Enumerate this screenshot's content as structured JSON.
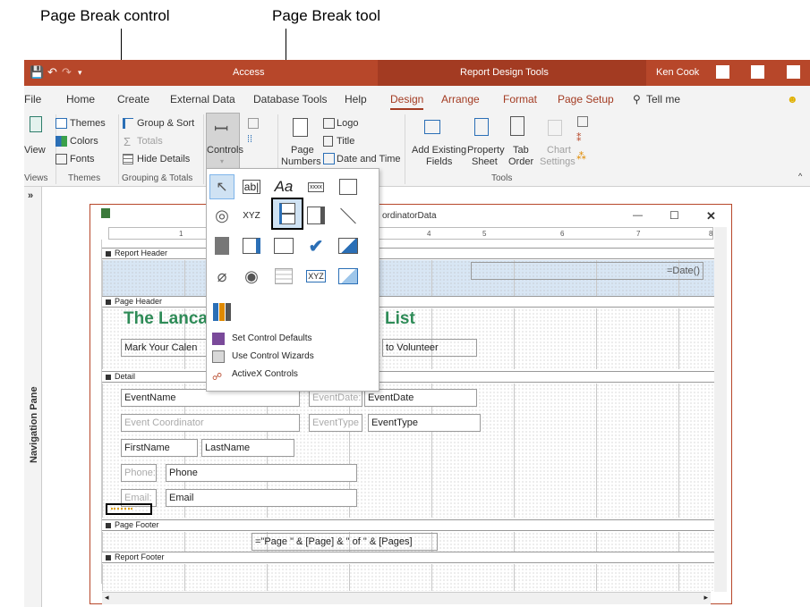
{
  "callouts": {
    "left": "Page Break control",
    "right": "Page Break tool"
  },
  "titlebar": {
    "app": "Access",
    "context": "Report Design Tools",
    "user": "Ken Cook",
    "quick_access": [
      "💾",
      "↶",
      "↷",
      "▾"
    ]
  },
  "tabs": [
    "File",
    "Home",
    "Create",
    "External Data",
    "Database Tools",
    "Help",
    "Design",
    "Arrange",
    "Format",
    "Page Setup"
  ],
  "tell_me": "Tell me",
  "ribbon": {
    "views": {
      "label": "View",
      "group": "Views"
    },
    "themes": {
      "items": [
        "Themes",
        "Colors",
        "Fonts"
      ],
      "group": "Themes"
    },
    "grouping": {
      "items": [
        "Group & Sort",
        "Totals",
        "Hide Details"
      ],
      "group": "Grouping & Totals"
    },
    "controls": {
      "label": "Controls"
    },
    "header": {
      "items": [
        "Logo",
        "Title",
        "Date and Time"
      ],
      "page_numbers": "Page Numbers",
      "page_numbers_1": "Page",
      "page_numbers_2": "Numbers"
    },
    "tools": {
      "add_existing_1": "Add Existing",
      "add_existing_2": "Fields",
      "property_1": "Property",
      "property_2": "Sheet",
      "tab_1": "Tab",
      "tab_2": "Order",
      "chart_1": "Chart",
      "chart_2": "Settings",
      "group": "Tools"
    }
  },
  "navigation_pane": {
    "label": "Navigation Pane",
    "toggle": "»"
  },
  "report_window": {
    "title": "ordinatorData",
    "controls": [
      "—",
      "☐",
      "✕"
    ],
    "ruler_marks": [
      "1",
      "4",
      "5",
      "6",
      "7",
      "8"
    ],
    "sections": {
      "report_header": "Report Header",
      "page_header": "Page Header",
      "detail": "Detail",
      "page_footer": "Page Footer",
      "report_footer": "Report Footer"
    },
    "report_header_date": "=Date()",
    "page_header_title_left": "The Lanca",
    "page_header_title_right": "List",
    "page_header_sub_left": "Mark Your Calen",
    "page_header_sub_right": "to Volunteer",
    "detail_fields": {
      "event_name": "EventName",
      "event_date_label": "EventDate:",
      "event_date": "EventDate",
      "event_coordinator": "Event Coordinator",
      "event_type_label": "EventType",
      "event_type": "EventType",
      "first_name": "FirstName",
      "last_name": "LastName",
      "phone_label": "Phone:",
      "phone": "Phone",
      "email_label": "Email:",
      "email": "Email"
    },
    "page_footer_expr": "=\"Page \" & [Page] & \" of \" & [Pages]"
  },
  "controls_menu": {
    "items": [
      "Set Control Defaults",
      "Use Control Wizards",
      "ActiveX Controls"
    ],
    "textbox_label": "ab|",
    "label_glyph": "Aa",
    "button_glyph": "xxxx",
    "xyz": "XYZ"
  },
  "colors": {
    "accent": "#b7472a",
    "title_green": "#2e8b57"
  }
}
